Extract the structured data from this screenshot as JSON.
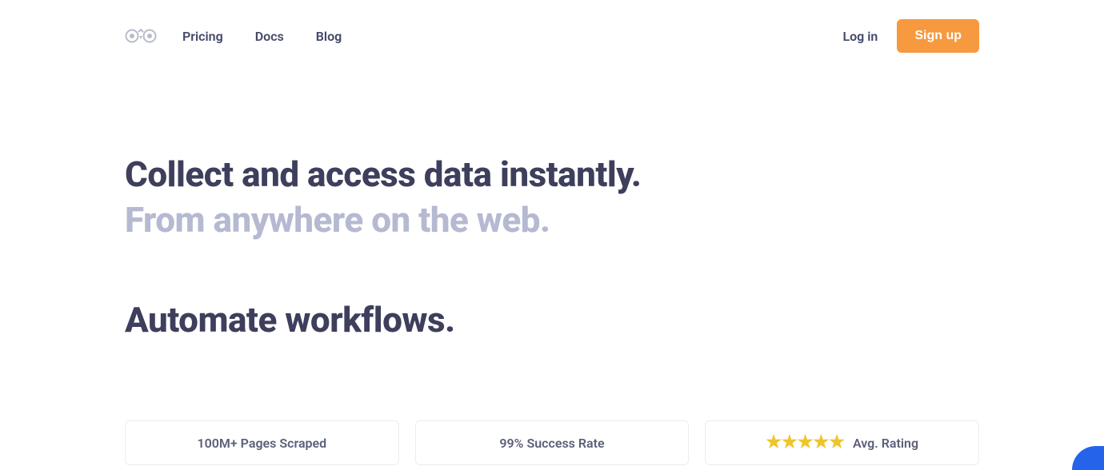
{
  "nav": {
    "links": [
      "Pricing",
      "Docs",
      "Blog"
    ],
    "login": "Log in",
    "signup": "Sign up"
  },
  "hero": {
    "title_line1": "Collect and access data instantly.",
    "title_line2": "From anywhere on the web.",
    "subtitle": "Automate workflows."
  },
  "stats": {
    "card1": "100M+ Pages Scraped",
    "card2": "99% Success Rate",
    "card3_label": "Avg. Rating",
    "card3_stars": 5
  }
}
